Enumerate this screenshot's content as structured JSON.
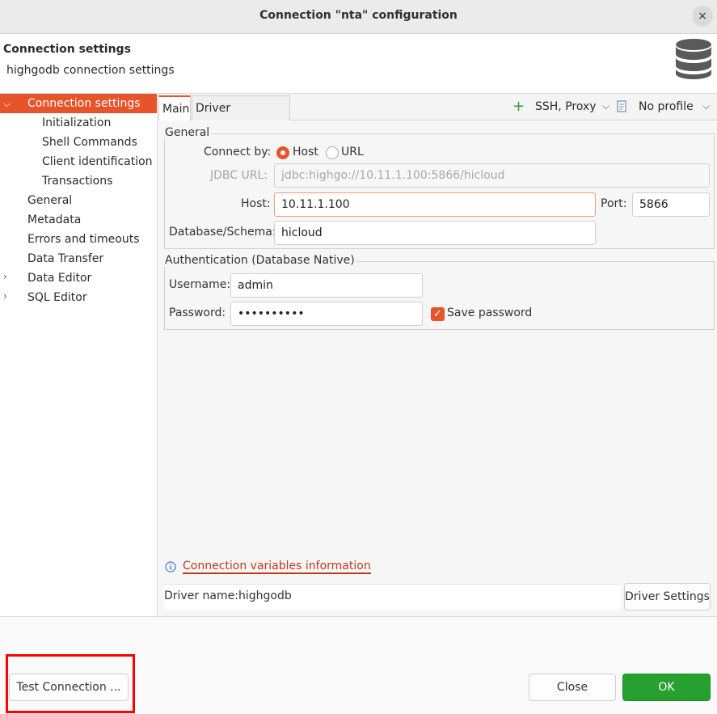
{
  "window": {
    "title": "Connection \"nta\" configuration",
    "close_symbol": "×"
  },
  "header": {
    "title": "Connection settings",
    "subtitle": "highgodb connection settings",
    "icon": "database-icon"
  },
  "nav": {
    "items": [
      {
        "label": "Connection settings",
        "selected": true,
        "expandable": true,
        "expanded": true
      },
      {
        "label": "Initialization"
      },
      {
        "label": "Shell Commands"
      },
      {
        "label": "Client identification"
      },
      {
        "label": "Transactions"
      },
      {
        "label": "General"
      },
      {
        "label": "Metadata"
      },
      {
        "label": "Errors and timeouts"
      },
      {
        "label": "Data Transfer"
      },
      {
        "label": "Data Editor",
        "expandable": true
      },
      {
        "label": "SQL Editor",
        "expandable": true
      }
    ]
  },
  "tabs": [
    {
      "label": "Main",
      "active": true
    },
    {
      "label": "Driver properties"
    }
  ],
  "toolbar": {
    "ssh_proxy": "SSH, Proxy",
    "profile": "No profile"
  },
  "general": {
    "legend": "General",
    "connect_by_label": "Connect by:",
    "options": [
      "Host",
      "URL"
    ],
    "selected_option": "Host",
    "jdbc_label": "JDBC URL:",
    "jdbc_value": "jdbc:highgo://10.11.1.100:5866/hicloud",
    "host_label": "Host:",
    "host_value": "10.11.1.100",
    "port_label": "Port:",
    "port_value": "5866",
    "db_label": "Database/Schema:",
    "db_value": "hicloud"
  },
  "auth": {
    "legend": "Authentication (Database Native)",
    "username_label": "Username:",
    "username_value": "admin",
    "password_label": "Password:",
    "password_value": "••••••••••",
    "save_password_label": "Save password",
    "save_password_checked": true
  },
  "info_link": "Connection variables information",
  "driver": {
    "label": "Driver name:",
    "value": "highgodb",
    "settings_button": "Driver Settings"
  },
  "footer": {
    "test_button": "Test Connection ...",
    "close_button": "Close",
    "ok_button": "OK"
  },
  "colors": {
    "accent": "#e8542a",
    "ok": "#26a12f",
    "highlight": "#ff0000"
  }
}
